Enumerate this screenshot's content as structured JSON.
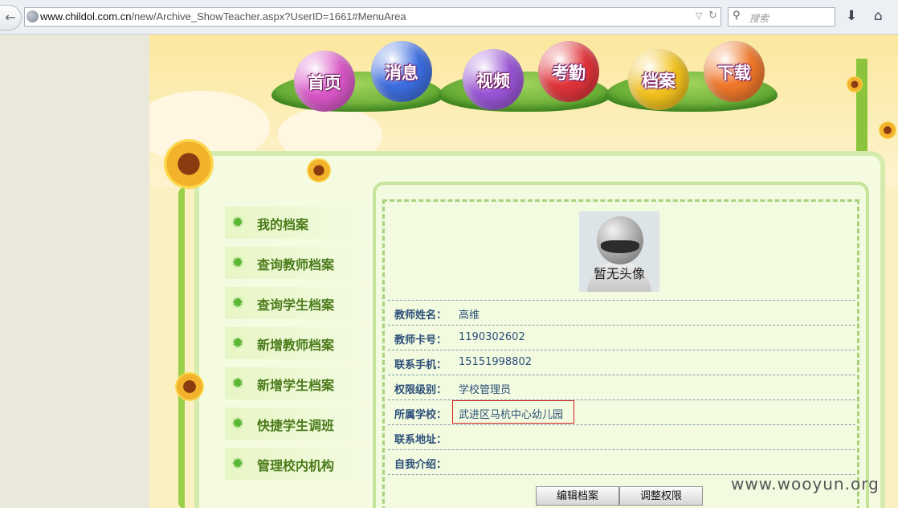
{
  "browser": {
    "url_domain": "www.childol.com.cn",
    "url_path": "/new/Archive_ShowTeacher.aspx?UserID=1661#MenuArea",
    "search_placeholder": "搜索",
    "icons": [
      "back-arrow-icon",
      "globe-icon",
      "dropdown-icon",
      "reload-icon",
      "search-icon",
      "download-icon",
      "home-icon"
    ]
  },
  "nav": {
    "items": [
      {
        "label": "首页",
        "color": "#d957c7"
      },
      {
        "label": "消息",
        "color": "#3d6ee0"
      },
      {
        "label": "视频",
        "color": "#9a55d6"
      },
      {
        "label": "考勤",
        "color": "#e0343a"
      },
      {
        "label": "档案",
        "color": "#f2c21d"
      },
      {
        "label": "下载",
        "color": "#f0782a"
      }
    ]
  },
  "sidebar": {
    "items": [
      {
        "label": "我的档案"
      },
      {
        "label": "查询教师档案"
      },
      {
        "label": "查询学生档案"
      },
      {
        "label": "新增教师档案"
      },
      {
        "label": "新增学生档案"
      },
      {
        "label": "快捷学生调班"
      },
      {
        "label": "管理校内机构"
      }
    ]
  },
  "profile": {
    "avatar_text": "暂无头像",
    "fields": [
      {
        "key": "教师姓名：",
        "value": "高维"
      },
      {
        "key": "教师卡号：",
        "value": "1190302602"
      },
      {
        "key": "联系手机：",
        "value": "15151998802"
      },
      {
        "key": "权限级别：",
        "value": "学校管理员"
      },
      {
        "key": "所属学校：",
        "value": "武进区马杭中心幼儿园"
      },
      {
        "key": "联系地址：",
        "value": ""
      },
      {
        "key": "自我介绍：",
        "value": ""
      }
    ],
    "edit_button": "编辑档案",
    "permission_button": "调整权限"
  },
  "watermark": "www.wooyun.org"
}
